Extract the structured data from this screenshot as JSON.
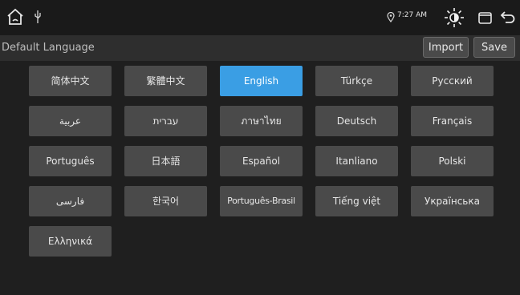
{
  "status_bar": {
    "icons": [
      "home-icon",
      "usb-icon",
      "location-icon",
      "brightness-icon",
      "window-icon",
      "back-icon"
    ],
    "time": "7:27 AM"
  },
  "header": {
    "title": "Default Language",
    "import_label": "Import",
    "save_label": "Save"
  },
  "languages": {
    "items": [
      {
        "label": "简体中文"
      },
      {
        "label": "繁體中文"
      },
      {
        "label": "English",
        "selected": true
      },
      {
        "label": "Türkçe"
      },
      {
        "label": "Русский"
      },
      {
        "label": "عربية"
      },
      {
        "label": "עברית"
      },
      {
        "label": "ภาษาไทย"
      },
      {
        "label": "Deutsch"
      },
      {
        "label": "Français"
      },
      {
        "label": "Português"
      },
      {
        "label": "日本語"
      },
      {
        "label": "Español"
      },
      {
        "label": "Itanliano"
      },
      {
        "label": "Polski"
      },
      {
        "label": "فارسی"
      },
      {
        "label": "한국어"
      },
      {
        "label": "Português-Brasil"
      },
      {
        "label": "Tiếng việt"
      },
      {
        "label": "Українська"
      },
      {
        "label": "Ελληνικά"
      }
    ],
    "selected_color": "#3a9ee4",
    "button_color": "#4a4a4a"
  }
}
